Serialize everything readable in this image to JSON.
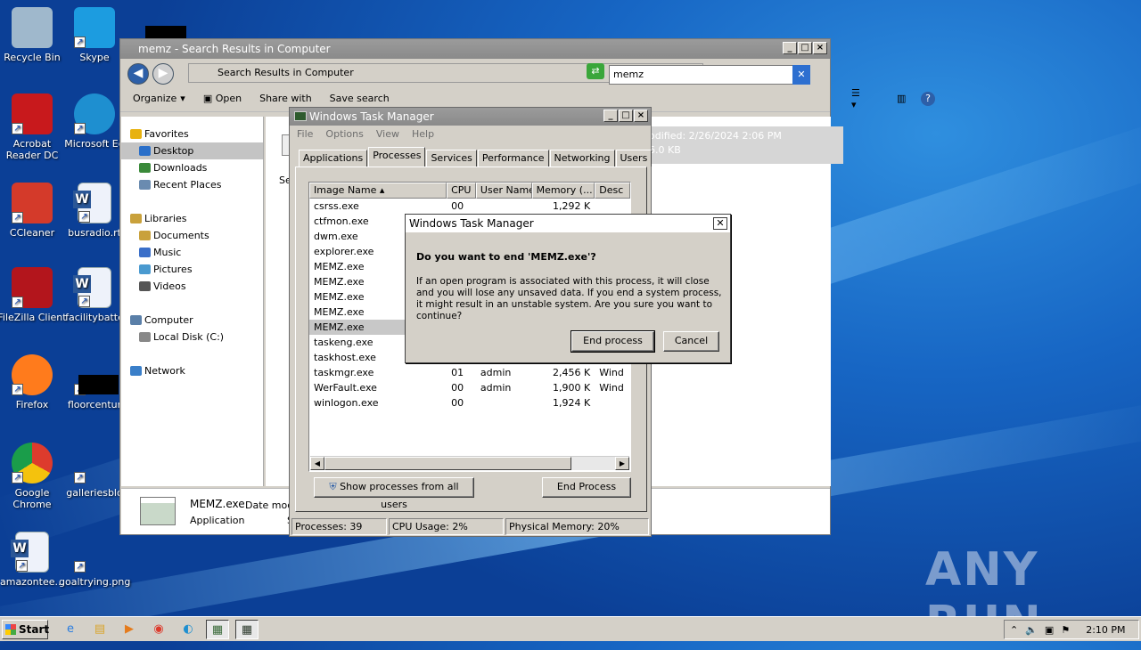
{
  "desktop": {
    "icons": [
      {
        "label": "Recycle Bin",
        "icon": "recycle-bin-icon"
      },
      {
        "label": "Skype",
        "icon": "skype-icon"
      },
      {
        "label": "Acrobat Reader DC",
        "icon": "acrobat-icon"
      },
      {
        "label": "Microsoft Ed",
        "icon": "edge-icon"
      },
      {
        "label": "CCleaner",
        "icon": "ccleaner-icon"
      },
      {
        "label": "busradio.rt",
        "icon": "word-doc-icon"
      },
      {
        "label": "FileZilla Client",
        "icon": "filezilla-icon"
      },
      {
        "label": "facilitybatte",
        "icon": "word-doc-icon"
      },
      {
        "label": "Firefox",
        "icon": "firefox-icon"
      },
      {
        "label": "floorcentur",
        "icon": "image-file-icon"
      },
      {
        "label": "Google Chrome",
        "icon": "chrome-icon"
      },
      {
        "label": "galleriesblo",
        "icon": "image-file-icon"
      },
      {
        "label": "amazontee...",
        "icon": "word-doc-icon"
      },
      {
        "label": "goaltrying.png",
        "icon": "image-file-icon"
      }
    ],
    "watermark": "ANY RUN"
  },
  "explorer": {
    "title": "memz - Search Results in Computer",
    "address": "Search Results in Computer",
    "search_value": "memz",
    "toolbar": {
      "organize": "Organize",
      "open": "Open",
      "share": "Share with",
      "save_search": "Save search"
    },
    "nav": [
      {
        "label": "Favorites",
        "header": true,
        "color": "#e8b20f"
      },
      {
        "label": "Desktop",
        "header": false,
        "color": "#2a6fc9",
        "selected": true
      },
      {
        "label": "Downloads",
        "header": false,
        "color": "#3a8a3a"
      },
      {
        "label": "Recent Places",
        "header": false,
        "color": "#6a8bb0"
      },
      {
        "label": "Libraries",
        "header": true,
        "color": "#c9a13b"
      },
      {
        "label": "Documents",
        "header": false,
        "color": "#c9a13b"
      },
      {
        "label": "Music",
        "header": false,
        "color": "#3a6fc9"
      },
      {
        "label": "Pictures",
        "header": false,
        "color": "#4a9ad0"
      },
      {
        "label": "Videos",
        "header": false,
        "color": "#555"
      },
      {
        "label": "Computer",
        "header": true,
        "color": "#5a7fa8"
      },
      {
        "label": "Local Disk (C:)",
        "header": false,
        "color": "#888"
      },
      {
        "label": "Network",
        "header": true,
        "color": "#3a7fc9"
      }
    ],
    "result_meta_1": "odified: 2/26/2024 2:06 PM",
    "result_meta_2": "6.0 KB",
    "search_again_fragment": "Se",
    "details": {
      "name": "MEMZ.exe",
      "date_label": "Date modi",
      "type": "Application",
      "frag": "S"
    }
  },
  "task_manager": {
    "title": "Windows Task Manager",
    "menu": [
      "File",
      "Options",
      "View",
      "Help"
    ],
    "tabs": [
      "Applications",
      "Processes",
      "Services",
      "Performance",
      "Networking",
      "Users"
    ],
    "active_tab": "Processes",
    "columns": [
      "Image Name",
      "CPU",
      "User Name",
      "Memory (...",
      "Desc"
    ],
    "rows": [
      {
        "name": "csrss.exe",
        "cpu": "00",
        "user": "",
        "mem": "1,292 K",
        "desc": ""
      },
      {
        "name": "ctfmon.exe",
        "cpu": "",
        "user": "",
        "mem": "",
        "desc": ""
      },
      {
        "name": "dwm.exe",
        "cpu": "",
        "user": "",
        "mem": "",
        "desc": ""
      },
      {
        "name": "explorer.exe",
        "cpu": "",
        "user": "",
        "mem": "",
        "desc": ""
      },
      {
        "name": "MEMZ.exe",
        "cpu": "",
        "user": "",
        "mem": "",
        "desc": ""
      },
      {
        "name": "MEMZ.exe",
        "cpu": "",
        "user": "",
        "mem": "",
        "desc": ""
      },
      {
        "name": "MEMZ.exe",
        "cpu": "",
        "user": "",
        "mem": "",
        "desc": ""
      },
      {
        "name": "MEMZ.exe",
        "cpu": "",
        "user": "",
        "mem": "",
        "desc": ""
      },
      {
        "name": "MEMZ.exe",
        "cpu": "",
        "user": "",
        "mem": "",
        "desc": "",
        "selected": true
      },
      {
        "name": "taskeng.exe",
        "cpu": "",
        "user": "",
        "mem": "",
        "desc": ""
      },
      {
        "name": "taskhost.exe",
        "cpu": "",
        "user": "",
        "mem": "",
        "desc": ""
      },
      {
        "name": "taskmgr.exe",
        "cpu": "01",
        "user": "admin",
        "mem": "2,456 K",
        "desc": "Wind"
      },
      {
        "name": "WerFault.exe",
        "cpu": "00",
        "user": "admin",
        "mem": "1,900 K",
        "desc": "Wind"
      },
      {
        "name": "winlogon.exe",
        "cpu": "00",
        "user": "",
        "mem": "1,924 K",
        "desc": ""
      }
    ],
    "show_all_label": "Show processes from all users",
    "end_process_label": "End Process",
    "status": {
      "processes": "Processes: 39",
      "cpu": "CPU Usage: 2%",
      "memory": "Physical Memory: 20%"
    }
  },
  "dialog": {
    "title": "Windows Task Manager",
    "question": "Do you want to end 'MEMZ.exe'?",
    "message": "If an open program is associated with this process, it will close and you will lose any unsaved data. If you end a system process, it might result in an unstable system. Are you sure you want to continue?",
    "end_label": "End process",
    "cancel_label": "Cancel"
  },
  "taskbar": {
    "start_label": "Start",
    "clock": "2:10 PM",
    "apps": [
      "ie-icon",
      "explorer-icon",
      "media-player-icon",
      "chrome-icon",
      "edge-icon",
      "task-manager-icon",
      "task-manager-active-icon"
    ]
  }
}
